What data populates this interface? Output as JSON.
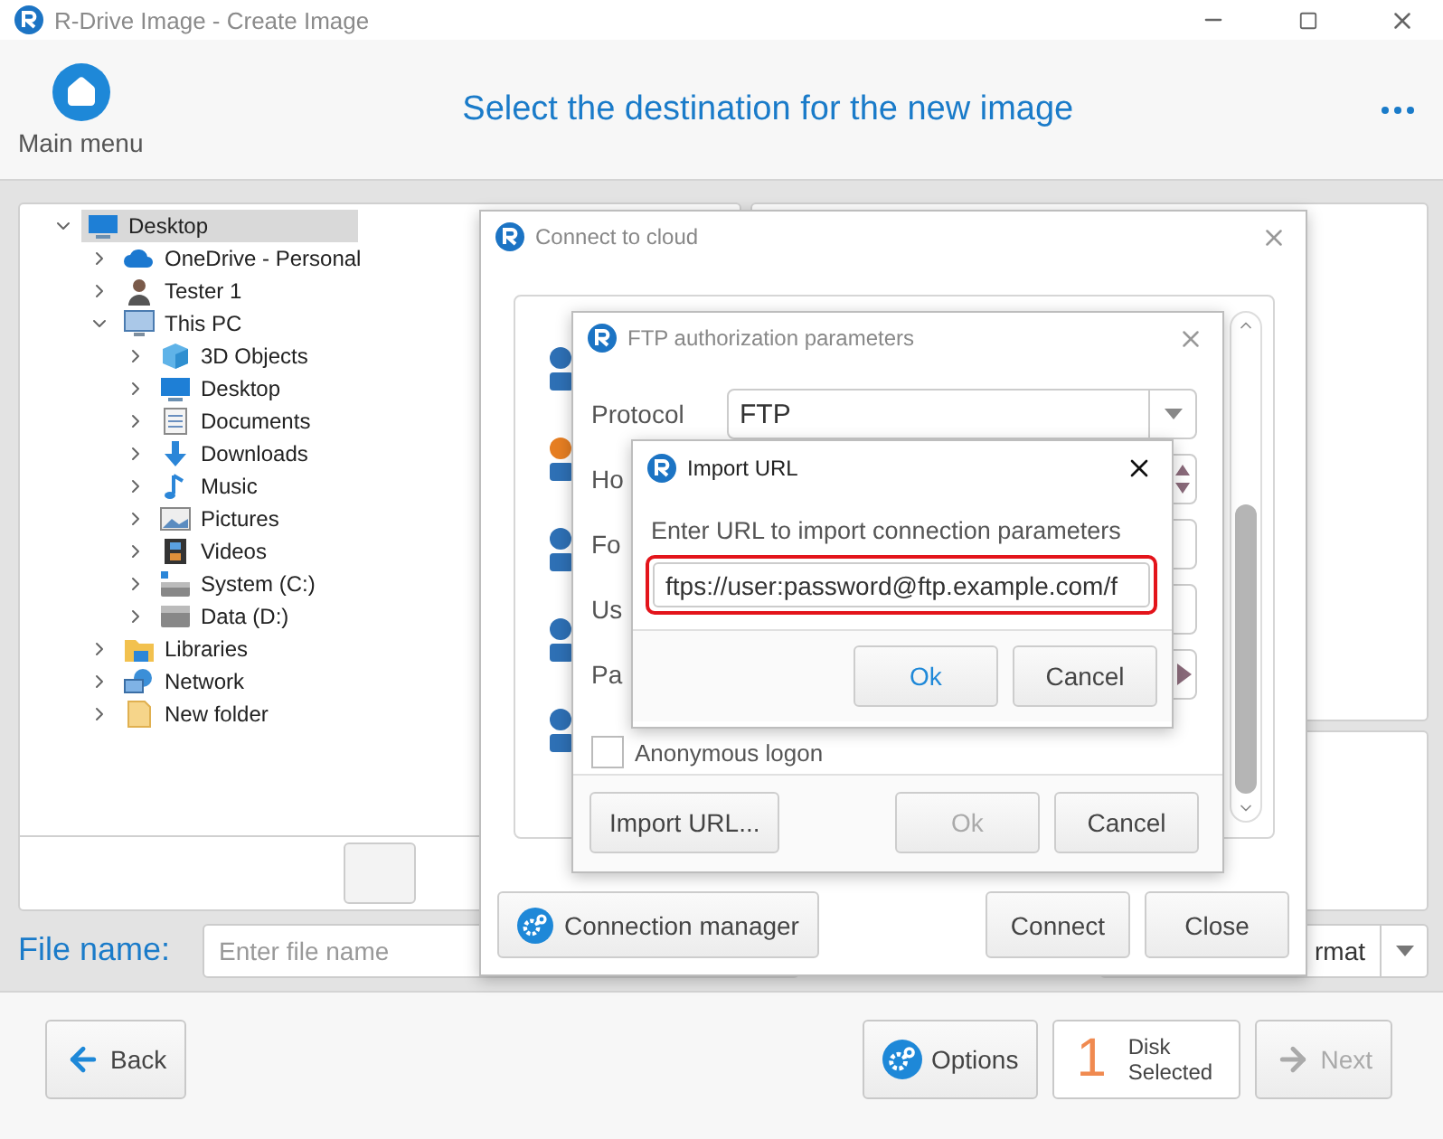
{
  "window": {
    "title": "R-Drive Image - Create Image"
  },
  "header": {
    "main_menu": "Main menu",
    "heading": "Select the destination for the new image"
  },
  "tree": [
    {
      "label": "Desktop",
      "kind": "desktop",
      "selected": true,
      "expanded": true,
      "children": [
        {
          "label": "OneDrive - Personal",
          "kind": "cloud",
          "selected": false,
          "expanded": false
        },
        {
          "label": "Tester 1",
          "kind": "user",
          "selected": false,
          "expanded": false
        },
        {
          "label": "This PC",
          "kind": "pc",
          "selected": false,
          "expanded": true,
          "children": [
            {
              "label": "3D Objects",
              "kind": "cube",
              "selected": false,
              "expanded": false
            },
            {
              "label": "Desktop",
              "kind": "desktop",
              "selected": false,
              "expanded": false
            },
            {
              "label": "Documents",
              "kind": "document",
              "selected": false,
              "expanded": false
            },
            {
              "label": "Downloads",
              "kind": "download",
              "selected": false,
              "expanded": false
            },
            {
              "label": "Music",
              "kind": "music",
              "selected": false,
              "expanded": false
            },
            {
              "label": "Pictures",
              "kind": "pictures",
              "selected": false,
              "expanded": false
            },
            {
              "label": "Videos",
              "kind": "videos",
              "selected": false,
              "expanded": false
            },
            {
              "label": "System (C:)",
              "kind": "system-drive",
              "selected": false,
              "expanded": false
            },
            {
              "label": "Data (D:)",
              "kind": "drive",
              "selected": false,
              "expanded": false
            }
          ]
        },
        {
          "label": "Libraries",
          "kind": "libraries",
          "selected": false,
          "expanded": false
        },
        {
          "label": "Network",
          "kind": "network",
          "selected": false,
          "expanded": false
        },
        {
          "label": "New folder",
          "kind": "folder",
          "selected": false,
          "expanded": false
        }
      ]
    }
  ],
  "file_name": {
    "label": "File name:",
    "placeholder": "Enter file name"
  },
  "format_select": {
    "value": "rmat"
  },
  "footer": {
    "back": "Back",
    "options": "Options",
    "disk_count": "1",
    "disk_word": "Disk",
    "disk_state": "Selected",
    "next": {
      "label": "Next",
      "disabled": true
    }
  },
  "connect_dialog": {
    "title": "Connect to cloud",
    "connection_manager": "Connection manager",
    "connect": "Connect",
    "close": "Close"
  },
  "ftp_dialog": {
    "title": "FTP authorization parameters",
    "protocol_label": "Protocol",
    "protocol_value": "FTP",
    "fields": [
      {
        "label": "Ho",
        "kind": "spinner"
      },
      {
        "label": "Fo",
        "kind": "text"
      },
      {
        "label": "Us",
        "kind": "text"
      },
      {
        "label": "Pa",
        "kind": "password"
      }
    ],
    "anonymous": {
      "label": "Anonymous logon",
      "checked": false
    },
    "import_button": "Import URL...",
    "ok": {
      "label": "Ok",
      "disabled": true
    },
    "cancel": "Cancel"
  },
  "import_dialog": {
    "title": "Import URL",
    "prompt": "Enter URL to import connection parameters",
    "url": "ftps://user:password@ftp.example.com/f",
    "ok": "Ok",
    "cancel": "Cancel"
  }
}
